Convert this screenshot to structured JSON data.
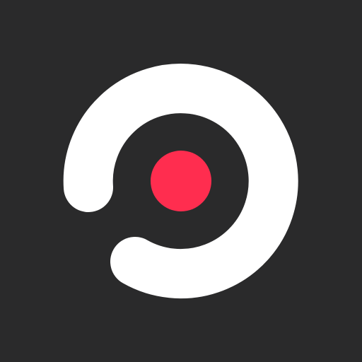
{
  "app_icon": {
    "icon_name": "record-disc-logo-icon",
    "colors": {
      "background": "#2a2a2b",
      "ring": "#ffffff",
      "dot": "#ff2d4f"
    }
  }
}
